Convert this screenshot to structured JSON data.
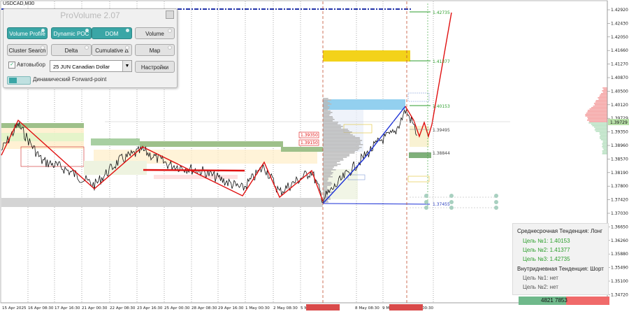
{
  "window": {
    "symbol": "USDCAD,M30"
  },
  "panel": {
    "title": "ProVolume 2.07",
    "buttons": [
      {
        "label": "Volume Profile",
        "state": "on"
      },
      {
        "label": "Dynamic POC",
        "state": "on"
      },
      {
        "label": "DOM",
        "state": "on"
      },
      {
        "label": "Volume",
        "state": "off"
      },
      {
        "label": "Cluster Search",
        "state": "off"
      },
      {
        "label": "Delta",
        "state": "off"
      },
      {
        "label": "Cumulative Δ",
        "state": "off"
      },
      {
        "label": "Map",
        "state": "off"
      }
    ],
    "auto_label": "Автовыбор",
    "instrument": "25 JUN Canadian Dollar",
    "settings_label": "Настройки",
    "forward_label": "Динамический Forward-point"
  },
  "price_axis": {
    "labels": [
      "1.42920",
      "1.42430",
      "1.42050",
      "1.41660",
      "1.41270",
      "1.40870",
      "1.40500",
      "1.40120",
      "1.39729",
      "1.39350",
      "1.38960",
      "1.38570",
      "1.38190",
      "1.37800",
      "1.37420",
      "1.37030",
      "1.36650",
      "1.36260",
      "1.35880",
      "1.35490",
      "1.35100",
      "1.34720"
    ],
    "current": "1.39729"
  },
  "time_axis": {
    "labels": [
      "15 Apr 2025",
      "16 Apr 08:30",
      "17 Apr 16:30",
      "21 Apr 00:30",
      "22 Apr 08:30",
      "23 Apr 16:30",
      "25 Apr 00:30",
      "28 Apr 08:30",
      "29 Apr 16:30",
      "1 May 00:30",
      "2 May 08:30",
      "5 M",
      "2025.05.06 19:30",
      "8 May 08:30",
      "9 M",
      "2025.05.12 20:30",
      "00:30"
    ]
  },
  "levels": [
    {
      "label": "1.42735",
      "color": "#2c9e2c"
    },
    {
      "label": "1.41377",
      "color": "#2c9e2c"
    },
    {
      "label": "1.40153",
      "color": "#2c9e2c"
    },
    {
      "label": "1.39495",
      "color": "#444444"
    },
    {
      "label": "1.38844",
      "color": "#444444"
    },
    {
      "label": "1.37455",
      "color": "#2b3fbf"
    }
  ],
  "mid_labels": [
    "1.39350",
    "1.39150"
  ],
  "trend_box": {
    "mid_title": "Среднесрочная Тенденция: Лонг",
    "mid_targets": [
      "Цель №1: 1.40153",
      "Цель №2: 1.41377",
      "Цель №3: 1.42735"
    ],
    "intra_title": "Внутридневная Тенденция: Шорт",
    "intra_targets": [
      "Цель №1: нет",
      "Цель №2: нет"
    ]
  },
  "volume_bar": {
    "text": "4821 7853",
    "buy_color": "#6fb98b",
    "sell_color": "#f06a6a"
  },
  "colors": {
    "up_trend": "#1a2fd6",
    "down_trend": "#e01010",
    "level_green": "#2c9e2c",
    "accent": "#3aa6a6"
  }
}
